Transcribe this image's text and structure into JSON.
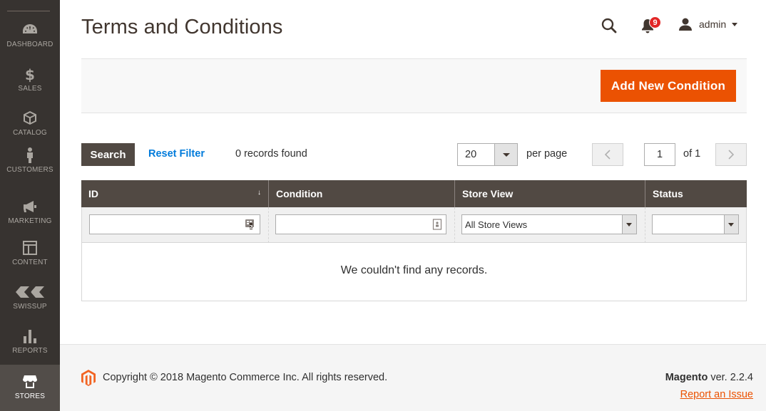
{
  "sidebar": {
    "items": [
      {
        "label": "DASHBOARD",
        "icon": "dashboard-icon"
      },
      {
        "label": "SALES",
        "icon": "dollar-icon"
      },
      {
        "label": "CATALOG",
        "icon": "box-icon"
      },
      {
        "label": "CUSTOMERS",
        "icon": "person-icon"
      },
      {
        "label": "MARKETING",
        "icon": "megaphone-icon"
      },
      {
        "label": "CONTENT",
        "icon": "layout-icon"
      },
      {
        "label": "SWISSUP",
        "icon": "swissup-icon"
      },
      {
        "label": "REPORTS",
        "icon": "bar-chart-icon"
      },
      {
        "label": "STORES",
        "icon": "store-icon",
        "active": true
      }
    ]
  },
  "header": {
    "title": "Terms and Conditions",
    "notifications_count": "9",
    "username": "admin"
  },
  "actions": {
    "add_label": "Add New Condition"
  },
  "toolbar": {
    "search_label": "Search",
    "reset_label": "Reset Filter",
    "records_text": "0 records found",
    "per_page_value": "20",
    "per_page_label": "per page",
    "current_page": "1",
    "page_of": "of 1"
  },
  "grid": {
    "columns": [
      "ID",
      "Condition",
      "Store View",
      "Status"
    ],
    "sort_indicator": "↓",
    "store_view_filter": "All Store Views",
    "status_filter": "",
    "empty_message": "We couldn't find any records."
  },
  "footer": {
    "copyright": "Copyright © 2018 Magento Commerce Inc. All rights reserved.",
    "brand": "Magento",
    "version": " ver. 2.2.4",
    "report_link": "Report an Issue"
  },
  "colors": {
    "accent": "#eb5202",
    "sidebar_bg": "#373330",
    "grid_header": "#514943",
    "link": "#007bdb"
  }
}
